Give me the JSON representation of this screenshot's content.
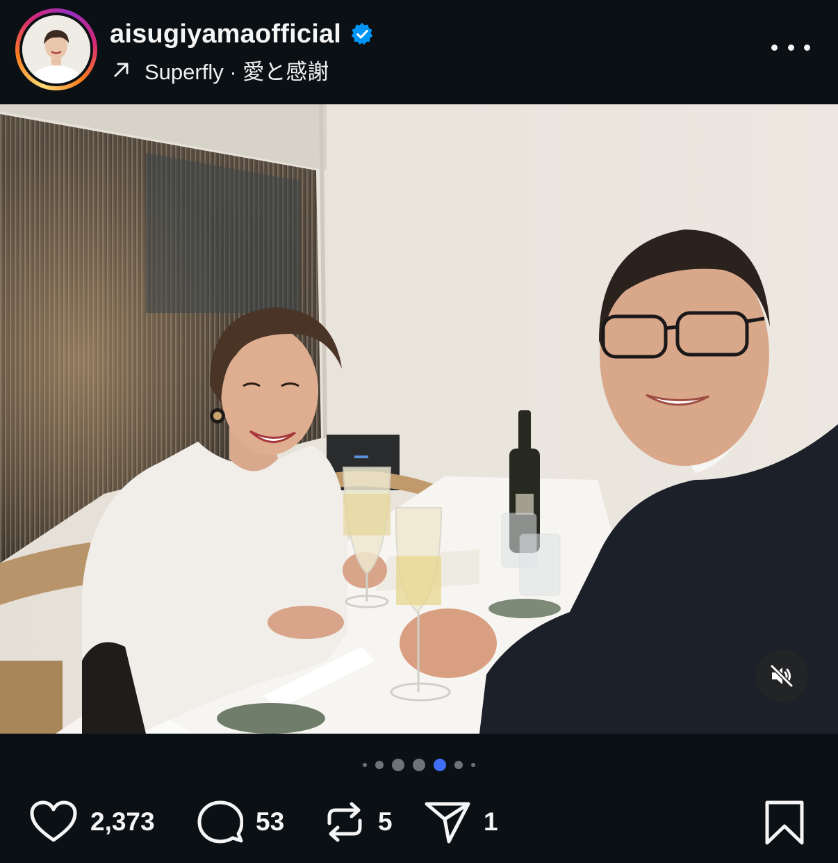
{
  "header": {
    "username": "aisugiyamaofficial",
    "verified": true,
    "music": "Superfly · 愛と感謝",
    "icons": {
      "music_arrow": "arrow-up-right-icon",
      "verified": "verified-badge-icon",
      "more": "more-dots-icon"
    }
  },
  "media": {
    "mute_icon": "speaker-muted-icon",
    "carousel": {
      "total_dots": 7,
      "active_index": 4
    }
  },
  "actions": {
    "likes": "2,373",
    "comments": "53",
    "reposts": "5",
    "shares": "1",
    "icons": [
      "heart-icon",
      "comment-icon",
      "repost-icon",
      "send-icon",
      "bookmark-icon"
    ]
  },
  "colors": {
    "background": "#0b1014",
    "verified_blue": "#0095f6",
    "active_dot": "#3d6ef5",
    "text": "#f5f5f5"
  }
}
